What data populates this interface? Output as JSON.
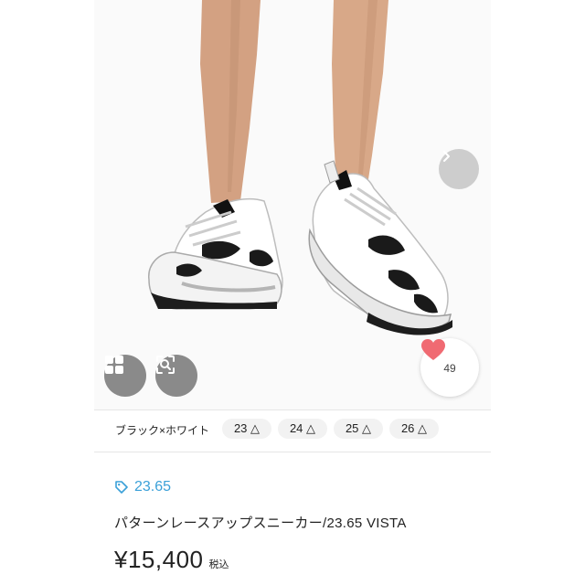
{
  "gallery": {
    "like_count": "49",
    "next_icon": "chevron-right-icon",
    "grid_icon": "grid-icon",
    "visual_search_icon": "image-search-icon",
    "heart_color": "#f06a72"
  },
  "variants": {
    "color": "ブラック×ホワイト",
    "sizes": [
      "23 △",
      "24 △",
      "25 △",
      "26 △"
    ]
  },
  "product": {
    "brand": "23.65",
    "brand_icon": "tag-icon",
    "brand_color": "#3aa0d8",
    "title": "パターンレースアップスニーカー/23.65 VISTA",
    "price": "¥15,400",
    "tax_label": "税込"
  }
}
